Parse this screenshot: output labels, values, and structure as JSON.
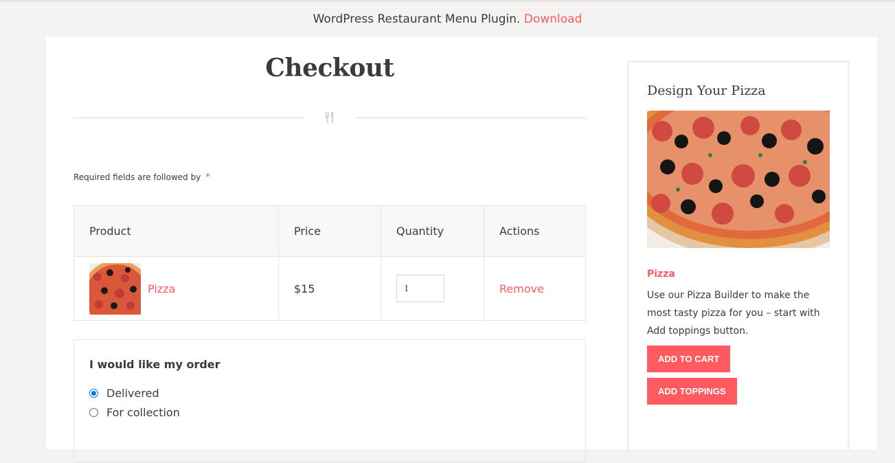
{
  "banner": {
    "text": "WordPress Restaurant Menu Plugin.",
    "link": "Download"
  },
  "page_title": "Checkout",
  "required_note": "Required fields are followed by",
  "required_marker": "*",
  "cart": {
    "headers": [
      "Product",
      "Price",
      "Quantity",
      "Actions"
    ],
    "items": [
      {
        "name": "Pizza",
        "price": "$15",
        "quantity": "1",
        "action": "Remove"
      }
    ]
  },
  "order_options": {
    "heading": "I would like my order",
    "options": [
      "Delivered",
      "For collection"
    ],
    "selected": "Delivered"
  },
  "sidebar": {
    "title": "Design Your Pizza",
    "product_name": "Pizza",
    "description": "Use our Pizza Builder to make the most tasty pizza for you – start with Add toppings button.",
    "buttons": {
      "add_to_cart": "ADD TO CART",
      "add_toppings": "ADD TOPPINGS"
    }
  },
  "colors": {
    "accent": "#ff5a5f",
    "radio": "#0075ff",
    "background": "#f5f3f1"
  }
}
